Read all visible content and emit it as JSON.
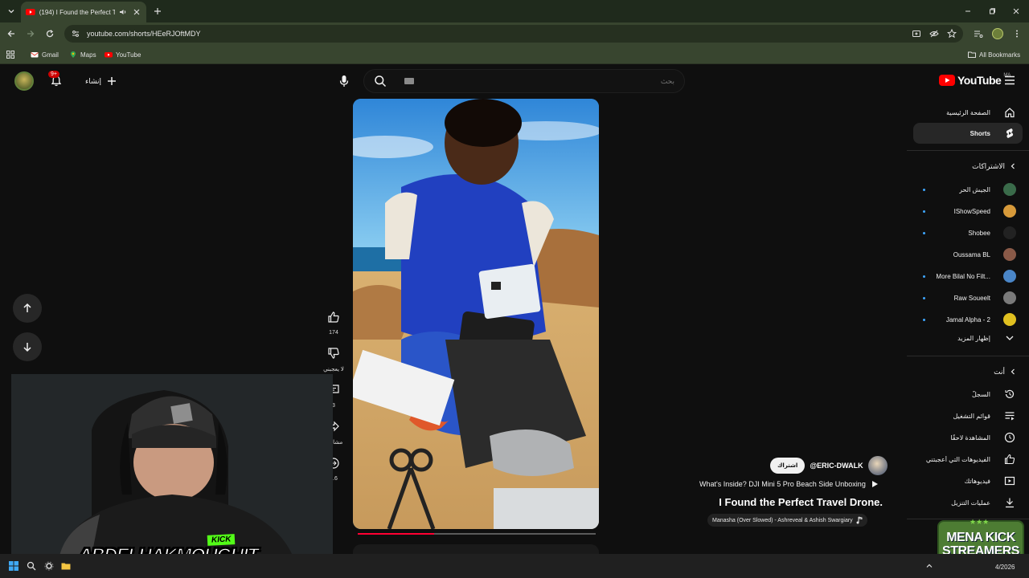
{
  "browser": {
    "tab_title": "(194) I Found the Perfect Tra",
    "url": "youtube.com/shorts/HEeRJOftMDY",
    "bookmarks": [
      "Gmail",
      "Maps",
      "YouTube"
    ],
    "all_bookmarks": "All Bookmarks"
  },
  "header": {
    "notification_count": "9+",
    "create_label": "إنشاء",
    "search_placeholder": "بحث",
    "logo_text": "YouTube",
    "region": "MA"
  },
  "short": {
    "like_count": "174",
    "dislike_label": "لا يعجبني",
    "comment_count": "3",
    "share_label": "مشاركة",
    "remix_count": "1.6",
    "channel": "@ERIC-DWALK",
    "subscribe_label": "اشتراك",
    "related_video": "What's Inside? DJI Mini 5 Pro Beach Side Unboxing",
    "title": "I Found the Perfect Travel Drone.",
    "sound": "Manasha (Over Slowed) - Ashreveal & Ashish Swargiary",
    "progress_fraction": 0.32
  },
  "sidebar": {
    "home": "الصفحة الرئيسية",
    "shorts": "Shorts",
    "subscriptions_head": "الاشتراكات",
    "subscriptions": [
      {
        "name": "الجيش الحر",
        "live": true,
        "color": "#3a6b4a"
      },
      {
        "name": "IShowSpeed",
        "live": true,
        "color": "#d79a3a"
      },
      {
        "name": "Shobee",
        "live": true,
        "color": "#222222"
      },
      {
        "name": "Oussama BL",
        "live": false,
        "color": "#8a5a48"
      },
      {
        "name": "More Bilal No Filt...",
        "live": true,
        "color": "#4a86c8"
      },
      {
        "name": "Raw Soueelt",
        "live": true,
        "color": "#7a7a7a"
      },
      {
        "name": "Jamal Alpha - 2",
        "live": true,
        "color": "#e0c020"
      }
    ],
    "show_more": "إظهار المزيد",
    "you_head": "أنت",
    "you_items": [
      "السجلّ",
      "قوائم التشغيل",
      "المشاهدة لاحقًا",
      "الفيديوهات التي أعجبتني",
      "فيديوهاتك",
      "عمليات التنزيل"
    ]
  },
  "overlay": {
    "streamer_name": "ABDELHAKMOUGHIT",
    "kick_tag": "KICK",
    "badge_line1": "MENA KICK",
    "badge_line2": "STREAMERS"
  },
  "taskbar": {
    "date_fragment": "4/2026"
  }
}
